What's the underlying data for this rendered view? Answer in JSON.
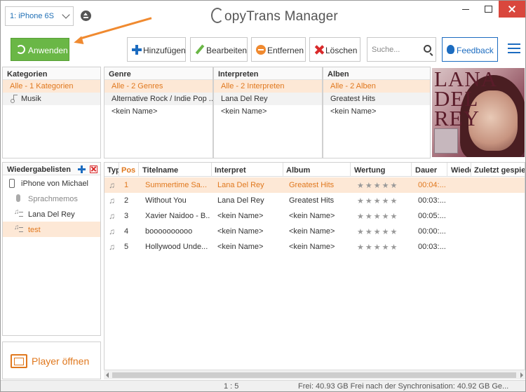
{
  "titlebar": {
    "device": "1: iPhone 6S",
    "app_title_prefix": "C",
    "app_title_rest": "opyTrans Manager"
  },
  "toolbar": {
    "apply": "Anwenden",
    "add": "Hinzufügen",
    "edit": "Bearbeiten",
    "remove": "Entfernen",
    "delete": "Löschen",
    "search_placeholder": "Suche...",
    "feedback": "Feedback"
  },
  "categories": {
    "header": "Kategorien",
    "items": [
      "Alle - 1 Kategorien",
      "Musik"
    ]
  },
  "genre": {
    "header": "Genre",
    "items": [
      "Alle - 2 Genres",
      "Alternative Rock / Indie Pop ...",
      "<kein Name>"
    ]
  },
  "artists": {
    "header": "Interpreten",
    "items": [
      "Alle - 2 Interpreten",
      "Lana Del Rey",
      "<kein Name>"
    ]
  },
  "albums": {
    "header": "Alben",
    "items": [
      "Alle - 2 Alben",
      "Greatest Hits",
      "<kein Name>"
    ]
  },
  "cover": {
    "text": "LANA\nDEL\nREY"
  },
  "playlists": {
    "header": "Wiedergabelisten",
    "device": "iPhone von Michael",
    "items": [
      "Sprachmemos",
      "Lana Del Rey",
      "test"
    ]
  },
  "player_button": "Player öffnen",
  "tracks": {
    "columns": [
      "Typ",
      "Pos",
      "Titelname",
      "Interpret",
      "Album",
      "Wertung",
      "Dauer",
      "Wiede",
      "Zuletzt gespielt"
    ],
    "rows": [
      {
        "pos": "1",
        "title": "Summertime Sa...",
        "artist": "Lana Del Rey",
        "album": "Greatest Hits",
        "rating": "★★★★★",
        "duration": "00:04:..."
      },
      {
        "pos": "2",
        "title": "Without You",
        "artist": "Lana Del Rey",
        "album": "Greatest Hits",
        "rating": "★★★★★",
        "duration": "00:03:..."
      },
      {
        "pos": "3",
        "title": "Xavier Naidoo - B...",
        "artist": "<kein Name>",
        "album": "<kein Name>",
        "rating": "★★★★★",
        "duration": "00:05:..."
      },
      {
        "pos": "4",
        "title": "boooooooooo",
        "artist": "<kein Name>",
        "album": "<kein Name>",
        "rating": "★★★★★",
        "duration": "00:00:..."
      },
      {
        "pos": "5",
        "title": "Hollywood Unde...",
        "artist": "<kein Name>",
        "album": "<kein Name>",
        "rating": "★★★★★",
        "duration": "00:03:..."
      }
    ]
  },
  "status": {
    "count": "1 : 5",
    "free": "Frei: 40.93 GB Frei nach der Synchronisation: 40.92 GB Ge..."
  },
  "colors": {
    "accent_orange": "#e0781e",
    "apply_green": "#6ab746",
    "brand_blue": "#1c6cc0",
    "selection_bg": "#fde8d6"
  }
}
